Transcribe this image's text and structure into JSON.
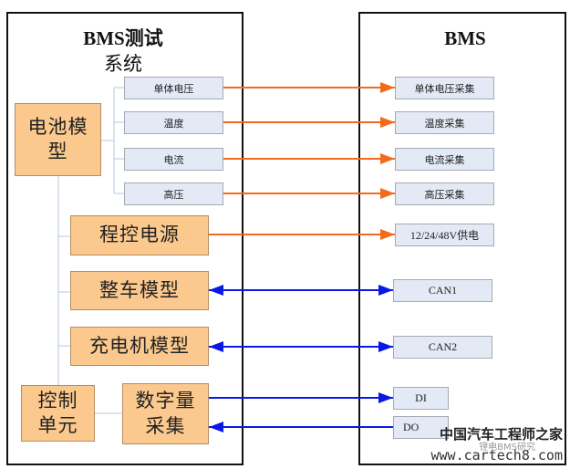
{
  "colors": {
    "orange_arrow": "#f26b1d",
    "blue_arrow": "#0a18e6",
    "connector": "#b7c9dd",
    "orange_box": "#fbc98e",
    "blue_box": "#e3eaf5"
  },
  "left": {
    "title_line1": "BMS测试",
    "title_line2": "系统",
    "battery_model": {
      "line1": "电池模",
      "line2": "型"
    },
    "battery_signals": [
      "单体电压",
      "温度",
      "电流",
      "高压"
    ],
    "programmable_power": "程控电源",
    "vehicle_model": "整车模型",
    "charger_model": "充电机模型",
    "control_unit": {
      "line1": "控制",
      "line2": "单元"
    },
    "digital_io": {
      "line1": "数字量",
      "line2": "采集"
    }
  },
  "right": {
    "title": "BMS",
    "acquisition": [
      "单体电压采集",
      "温度采集",
      "电流采集",
      "高压采集"
    ],
    "power_supply": "12/24/48V供电",
    "can1": "CAN1",
    "can2": "CAN2",
    "di": "DI",
    "do": "DO"
  },
  "connections": [
    {
      "from": "单体电压",
      "to": "单体电压采集",
      "type": "one-way",
      "color": "orange"
    },
    {
      "from": "温度",
      "to": "温度采集",
      "type": "one-way",
      "color": "orange"
    },
    {
      "from": "电流",
      "to": "电流采集",
      "type": "one-way",
      "color": "orange"
    },
    {
      "from": "高压",
      "to": "高压采集",
      "type": "one-way",
      "color": "orange"
    },
    {
      "from": "程控电源",
      "to": "12/24/48V供电",
      "type": "one-way",
      "color": "orange"
    },
    {
      "from": "整车模型",
      "to": "CAN1",
      "type": "two-way",
      "color": "blue"
    },
    {
      "from": "充电机模型",
      "to": "CAN2",
      "type": "two-way",
      "color": "blue"
    },
    {
      "from": "数字量采集",
      "to": "DI",
      "type": "one-way",
      "color": "blue"
    },
    {
      "from": "DO",
      "to": "数字量采集",
      "type": "one-way",
      "color": "blue"
    }
  ],
  "watermark": {
    "cn": "中国汽车工程师之家",
    "sub": "锂电BMS研究",
    "url": "www.cartech8.com"
  }
}
